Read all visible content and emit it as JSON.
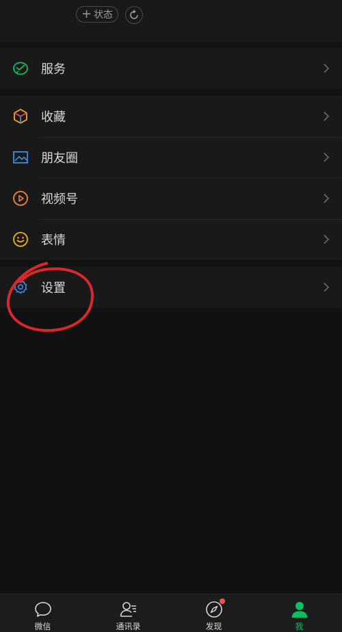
{
  "header": {
    "status_button_label": "状态",
    "status_button_icon": "plus-icon",
    "refresh_icon": "refresh-icon"
  },
  "menu_groups": [
    {
      "items": [
        {
          "label": "服务",
          "icon": "wechat-pay-icon",
          "icon_color": "#07c160"
        }
      ]
    },
    {
      "items": [
        {
          "label": "收藏",
          "icon": "cube-icon",
          "icon_color": "#f5a623"
        },
        {
          "label": "朋友圈",
          "icon": "image-icon",
          "icon_color": "#3a8ee6"
        },
        {
          "label": "视频号",
          "icon": "play-icon",
          "icon_color": "#f08a24"
        },
        {
          "label": "表情",
          "icon": "smile-icon",
          "icon_color": "#f5b400"
        }
      ]
    },
    {
      "items": [
        {
          "label": "设置",
          "icon": "gear-icon",
          "icon_color": "#3a8ee6"
        }
      ]
    }
  ],
  "tabbar": {
    "tabs": [
      {
        "label": "微信",
        "icon": "chat-bubble-icon",
        "active": false
      },
      {
        "label": "通讯录",
        "icon": "contacts-icon",
        "active": false
      },
      {
        "label": "发现",
        "icon": "compass-icon",
        "active": false,
        "badge_dot": true
      },
      {
        "label": "我",
        "icon": "person-icon",
        "active": true
      }
    ],
    "active_color": "#07c160"
  },
  "annotation": {
    "type": "hand-drawn-circle",
    "target": "设置",
    "color": "#d8282a"
  }
}
